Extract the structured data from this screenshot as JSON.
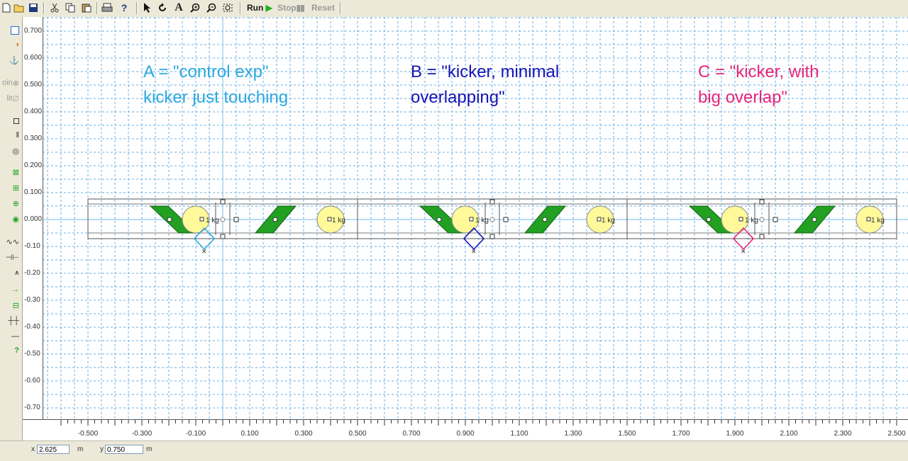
{
  "toolbar": {
    "run_label": "Run",
    "stop_label": "Stop",
    "reset_label": "Reset",
    "icons": [
      "new-icon",
      "open-icon",
      "save-icon",
      "cut-icon",
      "copy-icon",
      "paste-icon",
      "print-icon",
      "help-icon",
      "arrow-icon",
      "rotate-icon",
      "text-icon",
      "zoom-in-icon",
      "zoom-out-icon",
      "zoom-fit-icon"
    ]
  },
  "palette": {
    "join_label": "oin",
    "split_label": "lit"
  },
  "annotations": {
    "a_line1": "A = \"control exp\"",
    "a_line2": "kicker just touching",
    "b_line1": "B = \"kicker, minimal",
    "b_line2": "overlapping\"",
    "c_line1": "C = \"kicker, with",
    "c_line2": "big overlap\"",
    "colors": {
      "a": "#29a8e0",
      "b": "#1414b4",
      "c": "#e8267a"
    }
  },
  "ruler": {
    "y_labels": [
      "0.700",
      "0.600",
      "0.500",
      "0.400",
      "0.300",
      "0.200",
      "0.100",
      "0.000",
      "-0.10",
      "-0.20",
      "-0.30",
      "-0.40",
      "-0.50",
      "-0.60",
      "-0.70"
    ],
    "x_labels": [
      "-0.500",
      "-0.300",
      "-0.100",
      "0.100",
      "0.300",
      "0.500",
      "0.700",
      "0.900",
      "1.100",
      "1.300",
      "1.500",
      "1.700",
      "1.900",
      "2.100",
      "2.300",
      "2.500"
    ]
  },
  "bodies": {
    "mass_label": "1 kg"
  },
  "status": {
    "x_label": "x",
    "x_value": "2.625",
    "x_unit": "m",
    "y_label": "y",
    "y_value": "0.750",
    "y_unit": "m"
  },
  "colors": {
    "grid": "#6aaee0",
    "ball": "#fff99a",
    "kicker": "#22a022",
    "axis": "#8ec8f0"
  }
}
